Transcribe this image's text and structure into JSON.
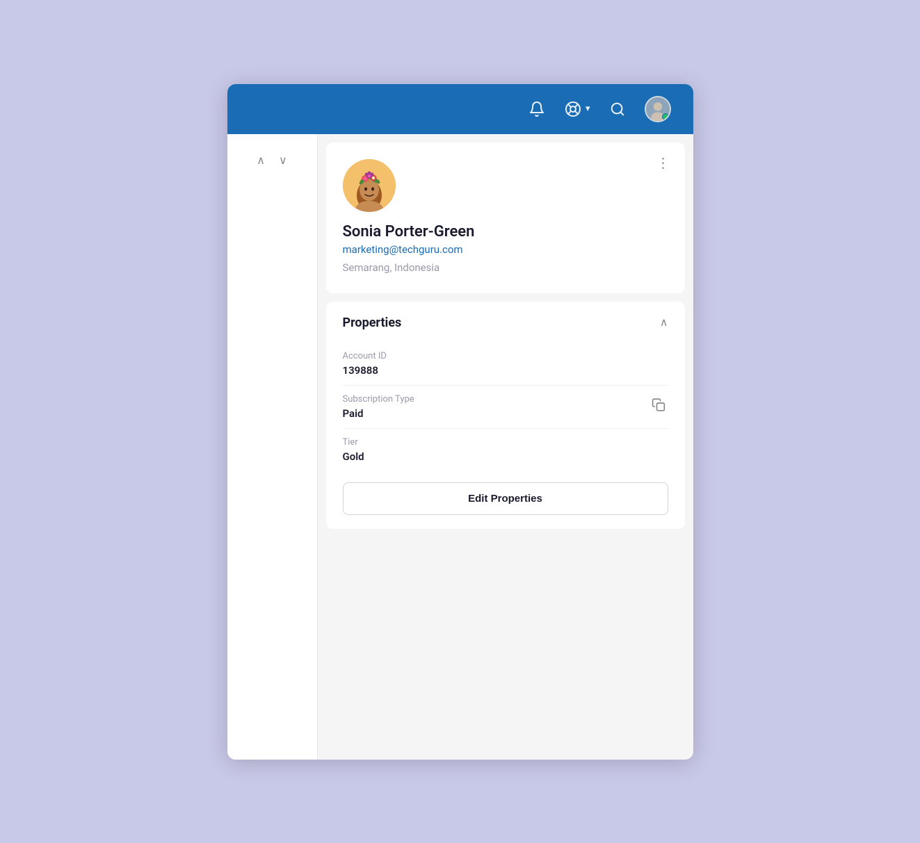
{
  "app": {
    "bg_color": "#c8c8e8",
    "window_color": "#f0f0f0"
  },
  "topnav": {
    "bell_icon": "🔔",
    "help_icon": "⊕",
    "search_icon": "🔍",
    "dropdown_label": "▾",
    "online_color": "#22c55e"
  },
  "sidebar": {
    "up_arrow": "∧",
    "down_arrow": "∨"
  },
  "profile": {
    "name": "Sonia Porter-Green",
    "email": "marketing@techguru.com",
    "location": "Semarang, Indonesia",
    "avatar_bg": "#f5c06b",
    "three_dot": "⋮"
  },
  "properties": {
    "title": "Properties",
    "collapse_icon": "∧",
    "account_id_label": "Account ID",
    "account_id_value": "139888",
    "subscription_type_label": "Subscription Type",
    "subscription_type_value": "Paid",
    "tier_label": "Tier",
    "tier_value": "Gold",
    "edit_button_label": "Edit Properties",
    "copy_icon": "⧉"
  }
}
